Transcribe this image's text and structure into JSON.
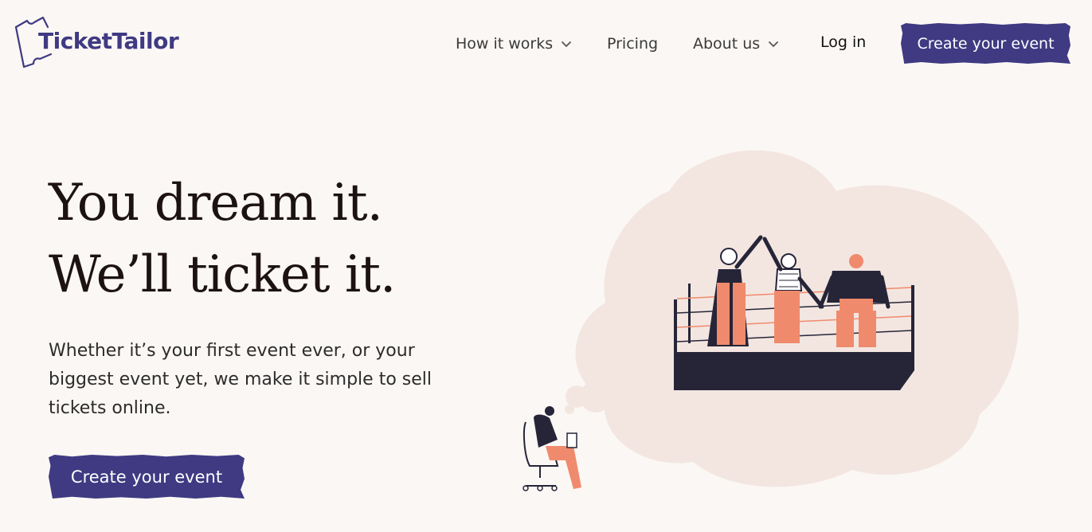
{
  "brand": {
    "name": "TicketTailor"
  },
  "nav": {
    "items": [
      {
        "label": "How it works",
        "has_dropdown": true
      },
      {
        "label": "Pricing",
        "has_dropdown": false
      },
      {
        "label": "About us",
        "has_dropdown": true
      }
    ],
    "login": "Log in",
    "cta": "Create your event"
  },
  "hero": {
    "headline_line1": "You dream it.",
    "headline_line2": "We’ll ticket it.",
    "subtext": "Whether it’s your first event ever, or your biggest event yet, we make it simple to sell tickets online.",
    "cta": "Create your event"
  },
  "colors": {
    "brand": "#3f3a82",
    "background": "#fbf7f4",
    "cloud": "#f3e6e1",
    "accent": "#f08a6c"
  },
  "icons": [
    "ticket-logo-icon",
    "chevron-down-icon"
  ]
}
